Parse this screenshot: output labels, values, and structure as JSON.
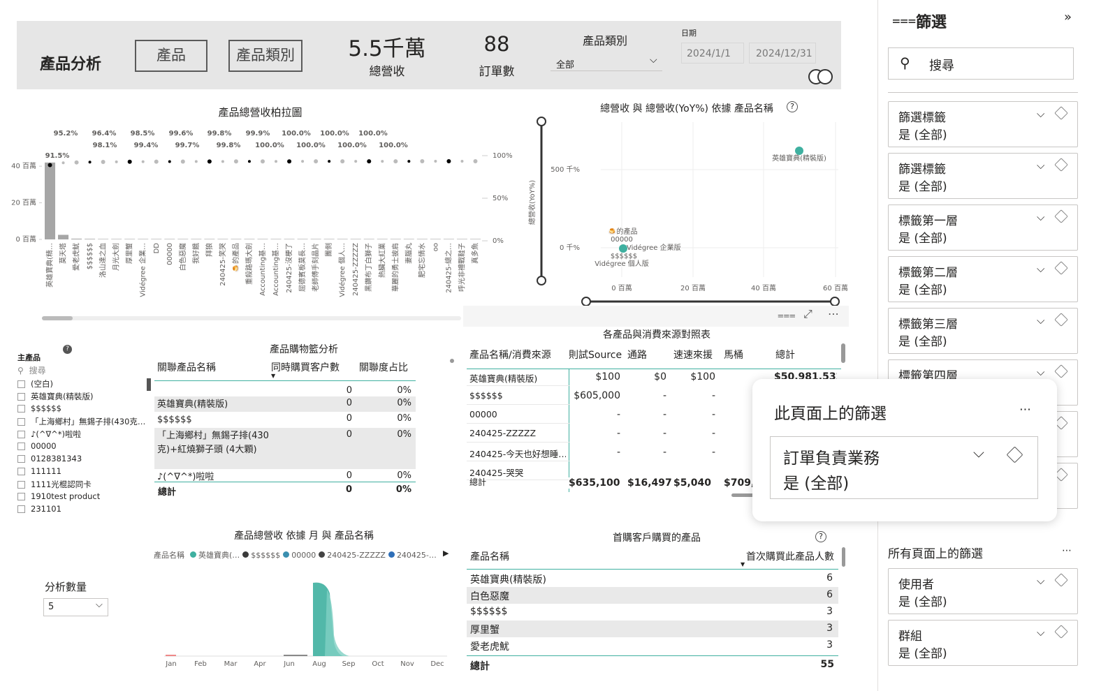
{
  "header": {
    "title": "產品分析",
    "btn_product": "產品",
    "btn_category": "產品類別",
    "kpi_revenue": "5.5千萬",
    "kpi_revenue_label": "總營收",
    "kpi_orders": "88",
    "kpi_orders_label": "訂單數",
    "category_label": "產品類別",
    "category_value": "全部",
    "date_label": "日期",
    "date_start": "2024/1/1",
    "date_end": "2024/12/31"
  },
  "pareto": {
    "title": "產品總營收柏拉圖",
    "y_ticks": [
      "40 百萬",
      "20 百萬",
      "0 百萬"
    ],
    "y2_ticks": [
      "100%",
      "50%",
      "0%"
    ],
    "pct_top": [
      "95.2%",
      "96.4%",
      "98.5%",
      "99.6%",
      "99.8%",
      "99.9%",
      "100.0%",
      "100.0%",
      "100.0%"
    ],
    "pct_bottom": [
      "98.1%",
      "99.4%",
      "99.7%",
      "99.8%",
      "100.0%",
      "100.0%",
      "100.0%",
      "100.0%"
    ],
    "pct_first": "91.5%",
    "categories": [
      "英雄寶典(精…",
      "莫天塔",
      "愛老虎魷",
      "$$$$$$",
      "洛山達之血",
      "月光大劍",
      "厚里蟹",
      "Vidégree 企業…",
      "DD",
      "00000",
      "白色惡魔",
      "我好餓",
      "拜狼",
      "240425-笑哭",
      "🍮的產品",
      "重殺路瑪大劍",
      "Accounting基…",
      "Accounting基…",
      "240425-沒梗了",
      "屈德賓板莫長…",
      "老師傅手刻晶片",
      "團側",
      "Vidégree 個人…",
      "240425-ZZZZZ",
      "黑鑽布丁白獅子",
      "熱臟大紅菓",
      "華麗的勇士披肩",
      "妻腦丸",
      "肥宅忘情水",
      "oo",
      "240425-總之…",
      "呼光非禮戰鞋子",
      "真多魚"
    ],
    "values": [
      42,
      2.5,
      0.4,
      0.3,
      0.2,
      0.1,
      0.1,
      0.1,
      0.05,
      0.05,
      0.04,
      0.04,
      0.03,
      0.03,
      0.03,
      0.02,
      0.02,
      0.02,
      0.02,
      0.02,
      0.01,
      0.01,
      0.01,
      0.01,
      0.01,
      0.01,
      0.01,
      0.01,
      0.01,
      0.01,
      0.01,
      0.01,
      0.01
    ]
  },
  "scatter": {
    "title": "總營收 與 總營收(YoY%) 依據 產品名稱",
    "ylabel": "總營收(YoY%)",
    "y_ticks": [
      "500 千%",
      "0 千%"
    ],
    "x_ticks": [
      "0 百萬",
      "20 百萬",
      "40 百萬",
      "60 百萬"
    ],
    "labels": [
      "英雄寶典(精裝版)",
      "🍮的產品",
      "00000",
      "Vidégree 企業版",
      "$$$$$$",
      "Vidégree 個人版"
    ]
  },
  "basket": {
    "title": "產品購物籃分析",
    "main_label": "主產品",
    "search_placeholder": "搜尋",
    "list": [
      "(空白)",
      "英雄寶典(精裝版)",
      "$$$$$$",
      "「上海鄉村」無錫子排(430克…",
      "♪(^∇^*)啦啦",
      "00000",
      "0128381343",
      "111111",
      "1111光棍認同卡",
      "1910test product",
      "231101"
    ],
    "col1": "關聯產品名稱",
    "col2": "同時購買客户數",
    "col3": "關聯度占比",
    "rows": [
      {
        "name": "",
        "count": "0",
        "pct": "0%"
      },
      {
        "name": "英雄寶典(精裝版)",
        "count": "0",
        "pct": "0%"
      },
      {
        "name": "$$$$$$",
        "count": "0",
        "pct": "0%"
      },
      {
        "name": "「上海鄉村」無錫子排(430克)+紅燒獅子頭 (4大顆)",
        "count": "0",
        "pct": "0%"
      },
      {
        "name": "♪(^∇^*)啦啦",
        "count": "0",
        "pct": "0%"
      }
    ],
    "total_label": "總計",
    "total_count": "0",
    "total_pct": "0%"
  },
  "matrix": {
    "title": "各產品與消費來源對照表",
    "headers": [
      "產品名稱/消費來源",
      "則試Source",
      "通路",
      "速速來援",
      "馬桶",
      "總計"
    ],
    "rows": [
      [
        "英雄寶典(精裝版)",
        "$100",
        "$0",
        "$100",
        "",
        "$50,981,532"
      ],
      [
        "$$$$$$",
        "$605,000",
        "-",
        "-",
        "",
        ""
      ],
      [
        "00000",
        "-",
        "-",
        "-",
        "",
        ""
      ],
      [
        "240425-ZZZZZ",
        "-",
        "-",
        "-",
        "",
        ""
      ],
      [
        "240425-今天也好想睡…",
        "-",
        "-",
        "-",
        "",
        ""
      ],
      [
        "240425-哭哭",
        "",
        "",
        "",
        "",
        ""
      ]
    ],
    "total": [
      "總計",
      "$635,100",
      "$16,497",
      "$5,040",
      "$709,",
      ""
    ]
  },
  "monthly": {
    "title": "產品總營收 依據 月 與 產品名稱",
    "legend_title": "產品名稱",
    "legend": [
      {
        "name": "英雄寶典(…",
        "color": "#3fb0a0"
      },
      {
        "name": "$$$$$$",
        "color": "#3b3b3b"
      },
      {
        "name": "00000",
        "color": "#3a8fb0"
      },
      {
        "name": "240425-ZZZZZ",
        "color": "#444"
      },
      {
        "name": "240425-…",
        "color": "#2f6fb8"
      }
    ],
    "months": [
      "Jan",
      "Feb",
      "Mar",
      "Apr",
      "Jun",
      "Aug",
      "Sep",
      "Oct",
      "Nov",
      "Dec"
    ],
    "count_label": "分析數量",
    "count_value": "5"
  },
  "firstbuy": {
    "title": "首購客戶購買的產品",
    "col1": "產品名稱",
    "col2": "首次購買此產品人數",
    "rows": [
      {
        "name": "英雄寶典(精裝版)",
        "n": "6"
      },
      {
        "name": "白色惡魔",
        "n": "6"
      },
      {
        "name": "$$$$$$",
        "n": "3"
      },
      {
        "name": "厚里蟹",
        "n": "3"
      },
      {
        "name": "愛老虎魷",
        "n": "3"
      }
    ],
    "total_label": "總計",
    "total_n": "55"
  },
  "filters": {
    "title": "篩選",
    "search_placeholder": "搜尋",
    "cards": [
      {
        "t": "篩選標籤",
        "v": "是 (全部)"
      },
      {
        "t": "篩選標籤",
        "v": "是 (全部)"
      },
      {
        "t": "標籤第一層",
        "v": "是 (全部)"
      },
      {
        "t": "標籤第二層",
        "v": "是 (全部)"
      },
      {
        "t": "標籤第三層",
        "v": "是 (全部)"
      },
      {
        "t": "標籤第四層",
        "v": ""
      }
    ],
    "all_pages_title": "所有頁面上的篩選",
    "all_cards": [
      {
        "t": "使用者",
        "v": "是 (全部)"
      },
      {
        "t": "群組",
        "v": "是 (全部)"
      }
    ]
  },
  "popup": {
    "title": "此頁面上的篩選",
    "card_title": "訂單負責業務",
    "card_value": "是 (全部)"
  }
}
